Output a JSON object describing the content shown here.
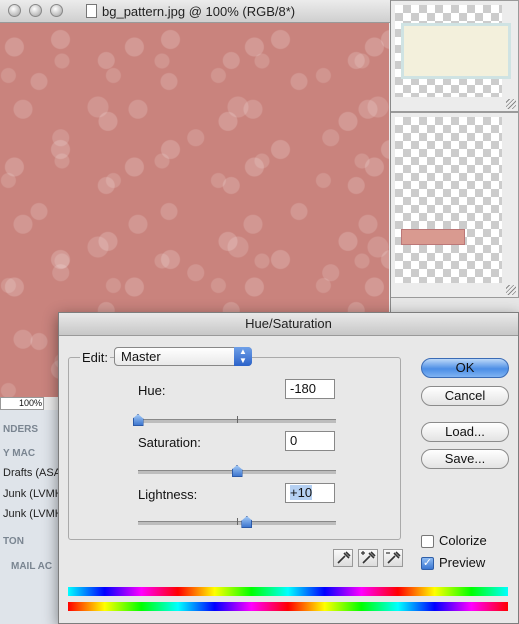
{
  "document": {
    "title": "bg_pattern.jpg @ 100% (RGB/8*)",
    "zoom": "100%",
    "pattern_color": "#c9837d"
  },
  "background_panel": {
    "zoom": "100%"
  },
  "mail_sidebar": {
    "items": [
      {
        "kind": "header",
        "text": "NDERS"
      },
      {
        "kind": "header",
        "text": "Y MAC"
      },
      {
        "kind": "item",
        "text": "Drafts (ASA"
      },
      {
        "kind": "item",
        "text": "Junk (LVMH"
      },
      {
        "kind": "item",
        "text": "Junk (LVMH"
      },
      {
        "kind": "header",
        "text": "TON"
      },
      {
        "kind": "header",
        "text": "MAIL AC"
      }
    ]
  },
  "dialog": {
    "title": "Hue/Saturation",
    "edit_label": "Edit:",
    "edit_value": "Master",
    "hue": {
      "label": "Hue:",
      "value": "-180",
      "slider": -180,
      "min": -180,
      "max": 180
    },
    "saturation": {
      "label": "Saturation:",
      "value": "0",
      "slider": 0,
      "min": -100,
      "max": 100
    },
    "lightness": {
      "label": "Lightness:",
      "value": "+10",
      "slider": 10,
      "min": -100,
      "max": 100
    },
    "buttons": {
      "ok": "OK",
      "cancel": "Cancel",
      "load": "Load...",
      "save": "Save..."
    },
    "colorize": {
      "label": "Colorize",
      "checked": false
    },
    "preview": {
      "label": "Preview",
      "checked": true
    },
    "eyedroppers": [
      "eyedropper-icon",
      "eyedropper-plus-icon",
      "eyedropper-minus-icon"
    ],
    "accent_color": "#4c8ee6"
  }
}
